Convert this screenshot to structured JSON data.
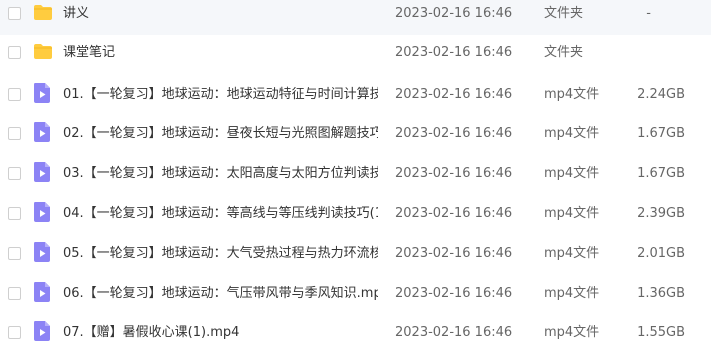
{
  "colors": {
    "folder_icon": "#FFCC3F",
    "video_icon": "#8C83F5",
    "text_primary": "#333333",
    "text_secondary": "#666666"
  },
  "files": [
    {
      "name": "讲义",
      "date": "2023-02-16 16:46",
      "type": "文件夹",
      "size": "-",
      "icon": "folder-icon"
    },
    {
      "name": "课堂笔记",
      "date": "2023-02-16 16:46",
      "type": "文件夹",
      "size": "",
      "icon": "folder-icon"
    },
    {
      "name": "01.【一轮复习】地球运动：地球运动特征与时间计算技...",
      "date": "2023-02-16 16:46",
      "type": "mp4文件",
      "size": "2.24GB",
      "icon": "video-icon"
    },
    {
      "name": "02.【一轮复习】地球运动：昼夜长短与光照图解题技巧....",
      "date": "2023-02-16 16:46",
      "type": "mp4文件",
      "size": "1.67GB",
      "icon": "video-icon"
    },
    {
      "name": "03.【一轮复习】地球运动：太阳高度与太阳方位判读技...",
      "date": "2023-02-16 16:46",
      "type": "mp4文件",
      "size": "1.67GB",
      "icon": "video-icon"
    },
    {
      "name": "04.【一轮复习】地球运动：等高线与等压线判读技巧(1)....",
      "date": "2023-02-16 16:46",
      "type": "mp4文件",
      "size": "2.39GB",
      "icon": "video-icon"
    },
    {
      "name": "05.【一轮复习】地球运动：大气受热过程与热力环流核...",
      "date": "2023-02-16 16:46",
      "type": "mp4文件",
      "size": "2.01GB",
      "icon": "video-icon"
    },
    {
      "name": "06.【一轮复习】地球运动：气压带风带与季风知识.mp4",
      "date": "2023-02-16 16:46",
      "type": "mp4文件",
      "size": "1.36GB",
      "icon": "video-icon"
    },
    {
      "name": "07.【赠】暑假收心课(1).mp4",
      "date": "2023-02-16 16:46",
      "type": "mp4文件",
      "size": "1.55GB",
      "icon": "video-icon"
    }
  ]
}
